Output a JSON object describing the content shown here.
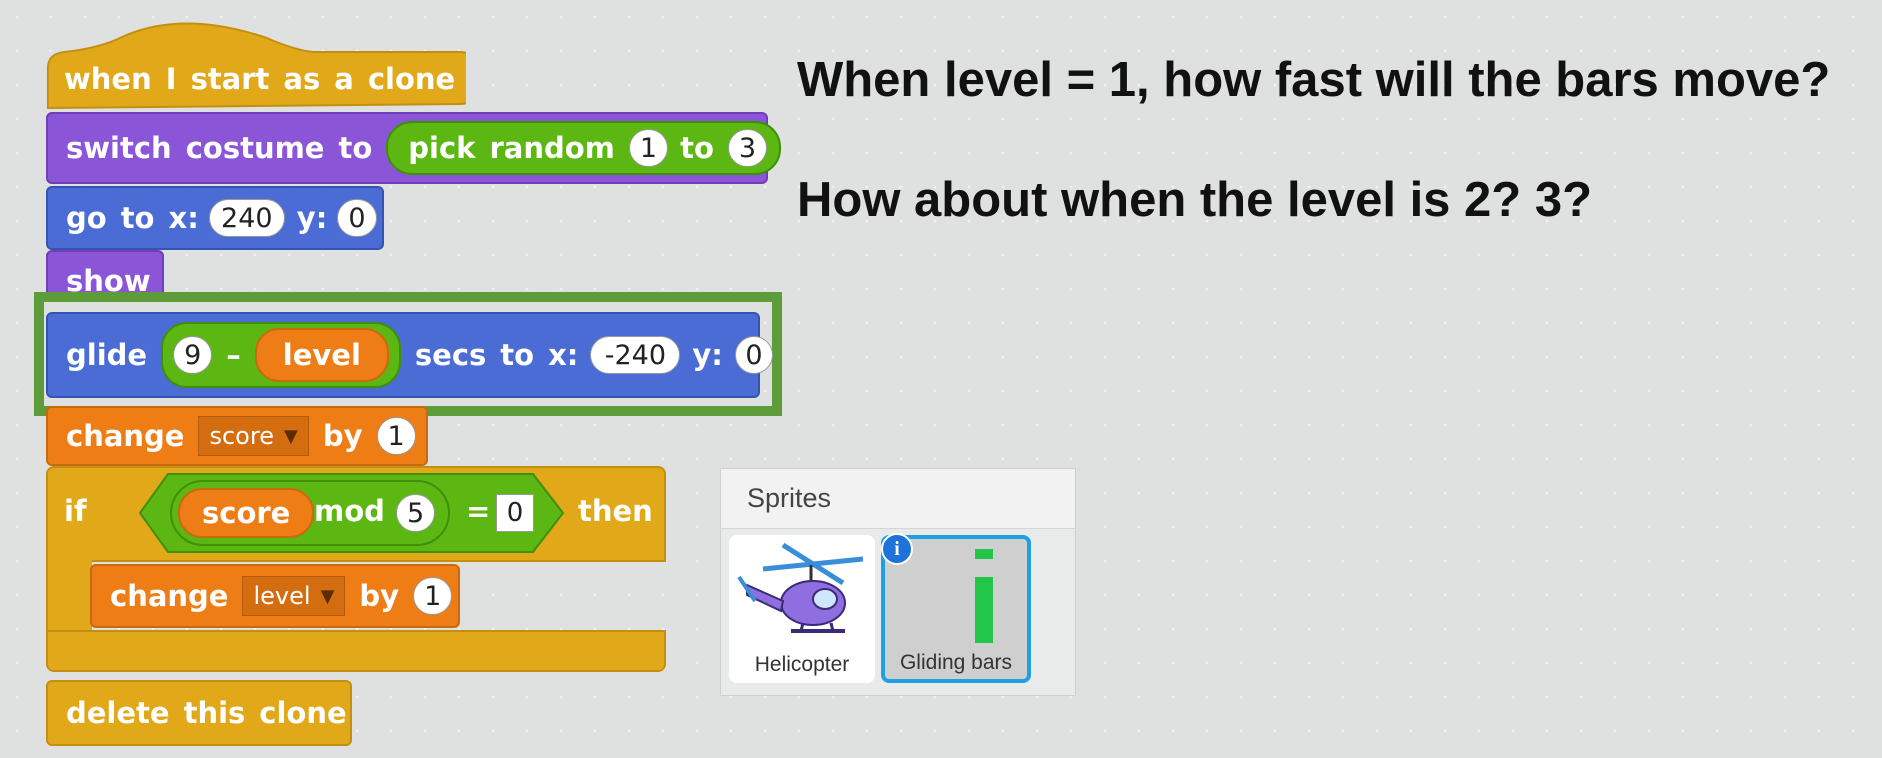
{
  "questions": {
    "q1": "When level = 1, how fast will the bars move?",
    "q2": "How about when the level is 2? 3?"
  },
  "script": {
    "hat": {
      "w1": "when",
      "w2": "I",
      "w3": "start",
      "w4": "as",
      "w5": "a",
      "w6": "clone"
    },
    "costume": {
      "w1": "switch",
      "w2": "costume",
      "w3": "to",
      "pick": "pick",
      "random": "random",
      "from": "1",
      "to_word": "to",
      "to": "3"
    },
    "goto": {
      "w1": "go",
      "w2": "to",
      "x_label": "x:",
      "x": "240",
      "y_label": "y:",
      "y": "0"
    },
    "show": {
      "label": "show"
    },
    "glide": {
      "w1": "glide",
      "a": "9",
      "minus": "–",
      "var": "level",
      "secs": "secs",
      "to": "to",
      "x_label": "x:",
      "x": "-240",
      "y_label": "y:",
      "y": "0"
    },
    "change_score": {
      "w1": "change",
      "var": "score",
      "by": "by",
      "value": "1"
    },
    "if_block": {
      "if_label": "if",
      "var": "score",
      "mod": "mod",
      "mod_value": "5",
      "eq": "=",
      "cmp": "0",
      "then": "then"
    },
    "change_level": {
      "w1": "change",
      "var": "level",
      "by": "by",
      "value": "1"
    },
    "delete": {
      "w1": "delete",
      "w2": "this",
      "w3": "clone"
    }
  },
  "highlight_color": "#5e9b3a",
  "sprites_panel": {
    "title": "Sprites",
    "items": [
      {
        "name": "Helicopter",
        "icon": "helicopter-icon",
        "selected": false
      },
      {
        "name": "Gliding bars",
        "icon": "bar-icon",
        "selected": true
      }
    ],
    "info_glyph": "i"
  }
}
